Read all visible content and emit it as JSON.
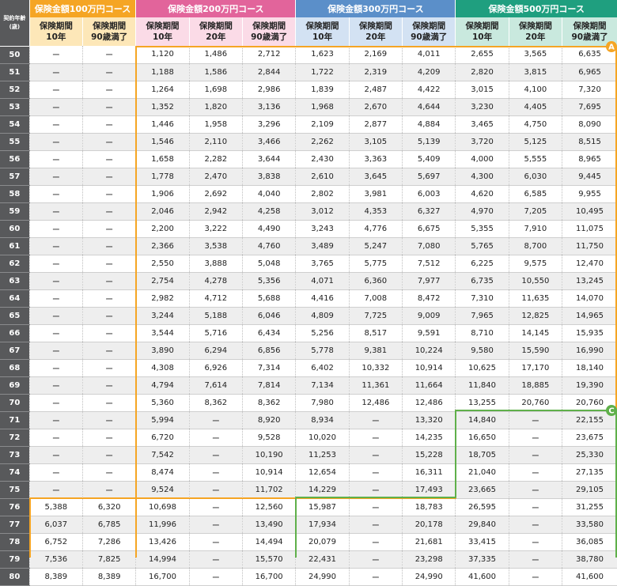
{
  "header": {
    "age_label_line1": "契約年齢",
    "age_label_line2": "(歳)",
    "courses": [
      {
        "label": "保険金額100万円コース",
        "color": "#f5a524"
      },
      {
        "label": "保険金額200万円コース",
        "color": "#e2649b"
      },
      {
        "label": "保険金額300万円コース",
        "color": "#5b8fc9"
      },
      {
        "label": "保険金額500万円コース",
        "color": "#1f9f7f"
      }
    ],
    "sub_headers": [
      [
        "保険期間",
        "10年"
      ],
      [
        "保険期間",
        "90歳満了"
      ],
      [
        "保険期間",
        "10年"
      ],
      [
        "保険期間",
        "20年"
      ],
      [
        "保険期間",
        "90歳満了"
      ],
      [
        "保険期間",
        "10年"
      ],
      [
        "保険期間",
        "20年"
      ],
      [
        "保険期間",
        "90歳満了"
      ],
      [
        "保険期間",
        "10年"
      ],
      [
        "保険期間",
        "20年"
      ],
      [
        "保険期間",
        "90歳満了"
      ]
    ]
  },
  "markers": {
    "a": {
      "label": "A",
      "color": "#f5a524"
    },
    "c": {
      "label": "C",
      "color": "#5fb04a"
    }
  },
  "rows": [
    {
      "age": "50",
      "values": [
        "ー",
        "ー",
        "1,120",
        "1,486",
        "2,712",
        "1,623",
        "2,169",
        "4,011",
        "2,655",
        "3,565",
        "6,635"
      ]
    },
    {
      "age": "51",
      "values": [
        "ー",
        "ー",
        "1,188",
        "1,586",
        "2,844",
        "1,722",
        "2,319",
        "4,209",
        "2,820",
        "3,815",
        "6,965"
      ]
    },
    {
      "age": "52",
      "values": [
        "ー",
        "ー",
        "1,264",
        "1,698",
        "2,986",
        "1,839",
        "2,487",
        "4,422",
        "3,015",
        "4,100",
        "7,320"
      ]
    },
    {
      "age": "53",
      "values": [
        "ー",
        "ー",
        "1,352",
        "1,820",
        "3,136",
        "1,968",
        "2,670",
        "4,644",
        "3,230",
        "4,405",
        "7,695"
      ]
    },
    {
      "age": "54",
      "values": [
        "ー",
        "ー",
        "1,446",
        "1,958",
        "3,296",
        "2,109",
        "2,877",
        "4,884",
        "3,465",
        "4,750",
        "8,090"
      ]
    },
    {
      "age": "55",
      "values": [
        "ー",
        "ー",
        "1,546",
        "2,110",
        "3,466",
        "2,262",
        "3,105",
        "5,139",
        "3,720",
        "5,125",
        "8,515"
      ]
    },
    {
      "age": "56",
      "values": [
        "ー",
        "ー",
        "1,658",
        "2,282",
        "3,644",
        "2,430",
        "3,363",
        "5,409",
        "4,000",
        "5,555",
        "8,965"
      ]
    },
    {
      "age": "57",
      "values": [
        "ー",
        "ー",
        "1,778",
        "2,470",
        "3,838",
        "2,610",
        "3,645",
        "5,697",
        "4,300",
        "6,030",
        "9,445"
      ]
    },
    {
      "age": "58",
      "values": [
        "ー",
        "ー",
        "1,906",
        "2,692",
        "4,040",
        "2,802",
        "3,981",
        "6,003",
        "4,620",
        "6,585",
        "9,955"
      ]
    },
    {
      "age": "59",
      "values": [
        "ー",
        "ー",
        "2,046",
        "2,942",
        "4,258",
        "3,012",
        "4,353",
        "6,327",
        "4,970",
        "7,205",
        "10,495"
      ]
    },
    {
      "age": "60",
      "values": [
        "ー",
        "ー",
        "2,200",
        "3,222",
        "4,490",
        "3,243",
        "4,776",
        "6,675",
        "5,355",
        "7,910",
        "11,075"
      ]
    },
    {
      "age": "61",
      "values": [
        "ー",
        "ー",
        "2,366",
        "3,538",
        "4,760",
        "3,489",
        "5,247",
        "7,080",
        "5,765",
        "8,700",
        "11,750"
      ]
    },
    {
      "age": "62",
      "values": [
        "ー",
        "ー",
        "2,550",
        "3,888",
        "5,048",
        "3,765",
        "5,775",
        "7,512",
        "6,225",
        "9,575",
        "12,470"
      ]
    },
    {
      "age": "63",
      "values": [
        "ー",
        "ー",
        "2,754",
        "4,278",
        "5,356",
        "4,071",
        "6,360",
        "7,977",
        "6,735",
        "10,550",
        "13,245"
      ]
    },
    {
      "age": "64",
      "values": [
        "ー",
        "ー",
        "2,982",
        "4,712",
        "5,688",
        "4,416",
        "7,008",
        "8,472",
        "7,310",
        "11,635",
        "14,070"
      ]
    },
    {
      "age": "65",
      "values": [
        "ー",
        "ー",
        "3,244",
        "5,188",
        "6,046",
        "4,809",
        "7,725",
        "9,009",
        "7,965",
        "12,825",
        "14,965"
      ]
    },
    {
      "age": "66",
      "values": [
        "ー",
        "ー",
        "3,544",
        "5,716",
        "6,434",
        "5,256",
        "8,517",
        "9,591",
        "8,710",
        "14,145",
        "15,935"
      ]
    },
    {
      "age": "67",
      "values": [
        "ー",
        "ー",
        "3,890",
        "6,294",
        "6,856",
        "5,778",
        "9,381",
        "10,224",
        "9,580",
        "15,590",
        "16,990"
      ]
    },
    {
      "age": "68",
      "values": [
        "ー",
        "ー",
        "4,308",
        "6,926",
        "7,314",
        "6,402",
        "10,332",
        "10,914",
        "10,625",
        "17,170",
        "18,140"
      ]
    },
    {
      "age": "69",
      "values": [
        "ー",
        "ー",
        "4,794",
        "7,614",
        "7,814",
        "7,134",
        "11,361",
        "11,664",
        "11,840",
        "18,885",
        "19,390"
      ]
    },
    {
      "age": "70",
      "values": [
        "ー",
        "ー",
        "5,360",
        "8,362",
        "8,362",
        "7,980",
        "12,486",
        "12,486",
        "13,255",
        "20,760",
        "20,760"
      ]
    },
    {
      "age": "71",
      "values": [
        "ー",
        "ー",
        "5,994",
        "ー",
        "8,920",
        "8,934",
        "ー",
        "13,320",
        "14,840",
        "ー",
        "22,155"
      ]
    },
    {
      "age": "72",
      "values": [
        "ー",
        "ー",
        "6,720",
        "ー",
        "9,528",
        "10,020",
        "ー",
        "14,235",
        "16,650",
        "ー",
        "23,675"
      ]
    },
    {
      "age": "73",
      "values": [
        "ー",
        "ー",
        "7,542",
        "ー",
        "10,190",
        "11,253",
        "ー",
        "15,228",
        "18,705",
        "ー",
        "25,330"
      ]
    },
    {
      "age": "74",
      "values": [
        "ー",
        "ー",
        "8,474",
        "ー",
        "10,914",
        "12,654",
        "ー",
        "16,311",
        "21,040",
        "ー",
        "27,135"
      ]
    },
    {
      "age": "75",
      "values": [
        "ー",
        "ー",
        "9,524",
        "ー",
        "11,702",
        "14,229",
        "ー",
        "17,493",
        "23,665",
        "ー",
        "29,105"
      ]
    },
    {
      "age": "76",
      "values": [
        "5,388",
        "6,320",
        "10,698",
        "ー",
        "12,560",
        "15,987",
        "ー",
        "18,783",
        "26,595",
        "ー",
        "31,255"
      ]
    },
    {
      "age": "77",
      "values": [
        "6,037",
        "6,785",
        "11,996",
        "ー",
        "13,490",
        "17,934",
        "ー",
        "20,178",
        "29,840",
        "ー",
        "33,580"
      ]
    },
    {
      "age": "78",
      "values": [
        "6,752",
        "7,286",
        "13,426",
        "ー",
        "14,494",
        "20,079",
        "ー",
        "21,681",
        "33,415",
        "ー",
        "36,085"
      ]
    },
    {
      "age": "79",
      "values": [
        "7,536",
        "7,825",
        "14,994",
        "ー",
        "15,570",
        "22,431",
        "ー",
        "23,298",
        "37,335",
        "ー",
        "38,780"
      ]
    },
    {
      "age": "80",
      "values": [
        "8,389",
        "8,389",
        "16,700",
        "ー",
        "16,700",
        "24,990",
        "ー",
        "24,990",
        "41,600",
        "ー",
        "41,600"
      ]
    }
  ]
}
